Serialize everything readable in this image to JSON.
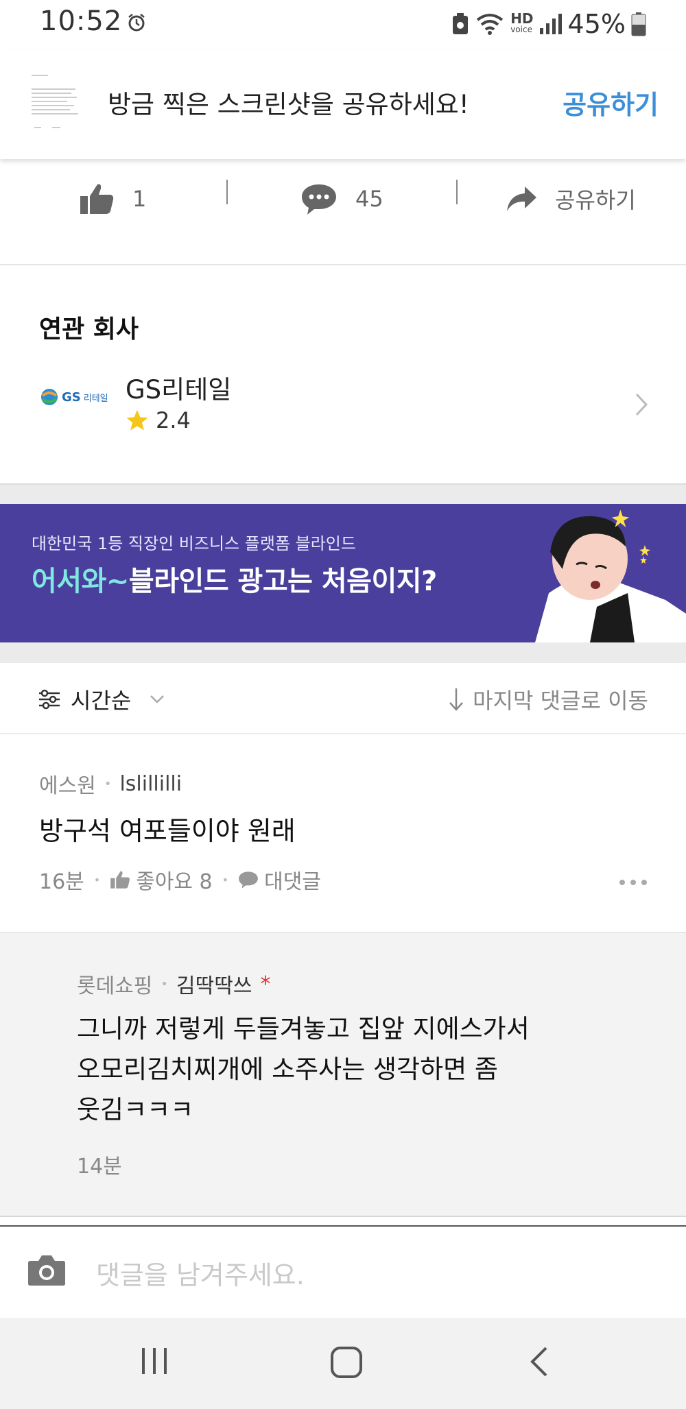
{
  "status_bar": {
    "time": "10:52",
    "battery_pct": "45%",
    "hd_label": "HD",
    "voice_label": "voice"
  },
  "share_banner": {
    "text": "방금 찍은 스크린샷을 공유하세요!",
    "action_label": "공유하기"
  },
  "actions": {
    "like_count": "1",
    "comment_count": "45",
    "share_label": "공유하기"
  },
  "related": {
    "title": "연관 회사",
    "company_name": "GS리테일",
    "logo_text": "GS",
    "logo_sub": "리테일",
    "rating": "2.4",
    "rating_fraction": 0.48
  },
  "ad": {
    "sub_text": "대한민국 1등 직장인 비즈니스 플랫폼 블라인드",
    "main_highlight": "어서와~",
    "main_rest": "블라인드 광고는 처음이지?"
  },
  "sort_bar": {
    "sort_label": "시간순",
    "jump_label": "마지막 댓글로 이동"
  },
  "comment": {
    "company": "에스원",
    "user": "lslillilli",
    "body": "방구석 여포들이야 원래",
    "time": "16분",
    "like_label": "좋아요 8",
    "reply_label": "대댓글"
  },
  "reply": {
    "company": "롯데쇼핑",
    "user": "김딱딱쓰",
    "author_mark": "*",
    "line1": "그니까 저렇게 두들겨놓고 집앞 지에스가서",
    "line2": "오모리김치찌개에 소주사는 생각하면 좀",
    "line3": "웃김ㅋㅋㅋ",
    "time": "14분"
  },
  "input": {
    "placeholder": "댓글을 남겨주세요."
  },
  "colors": {
    "accent": "#3b8fd8",
    "ad_bg": "#4a3f9c",
    "ad_highlight": "#7fe8e0",
    "star": "#f5c518",
    "author_mark": "#e0332f"
  }
}
